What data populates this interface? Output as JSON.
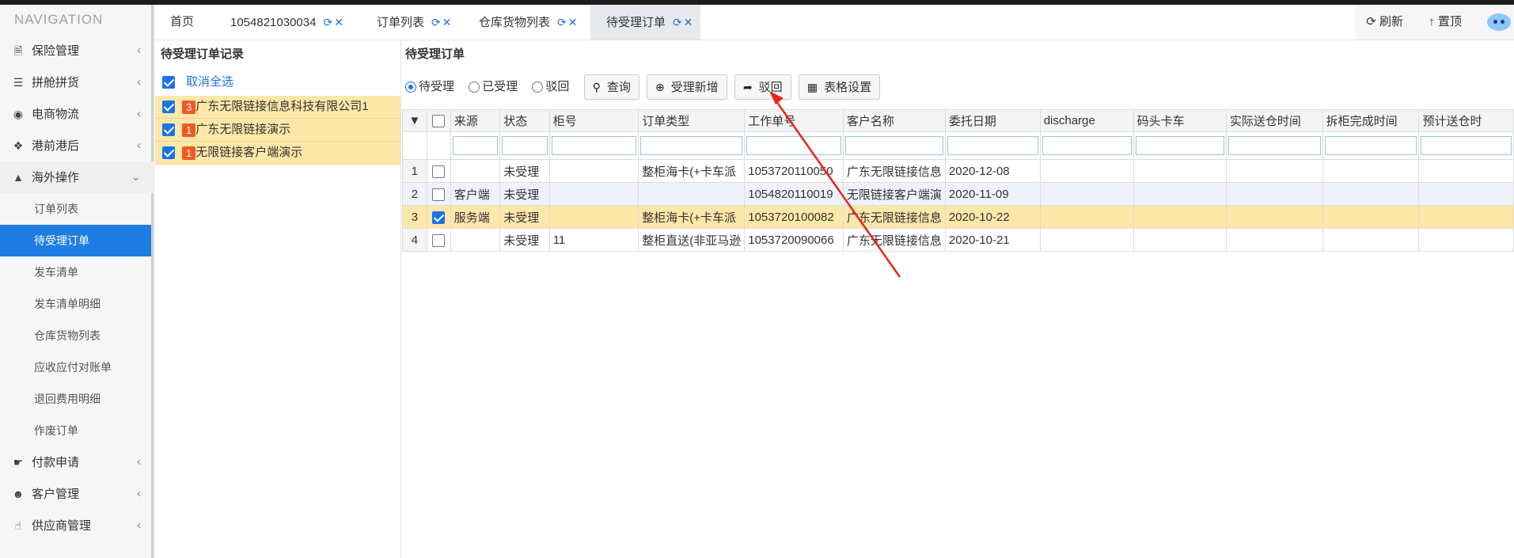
{
  "sidebar": {
    "title": "NAVIGATION",
    "menu": [
      {
        "label": "保险管理",
        "icon": "document-icon"
      },
      {
        "label": "拼舱拼货",
        "icon": "list-icon"
      },
      {
        "label": "电商物流",
        "icon": "globe-icon"
      },
      {
        "label": "港前港后",
        "icon": "cubes-icon"
      },
      {
        "label": "海外操作",
        "icon": "bank-icon",
        "expanded": true
      }
    ],
    "submenu": [
      "订单列表",
      "待受理订单",
      "发车清单",
      "发车清单明细",
      "仓库货物列表",
      "应收应付对账单",
      "退回费用明细",
      "作废订单"
    ],
    "active_sub": "待受理订单",
    "menu_after": [
      {
        "label": "付款申请",
        "icon": "hand-coins-icon"
      },
      {
        "label": "客户管理",
        "icon": "users-icon"
      },
      {
        "label": "供应商管理",
        "icon": "thumbs-up-icon"
      }
    ]
  },
  "tabs": [
    {
      "label": "首页",
      "refreshable": false
    },
    {
      "label": "1054821030034",
      "refreshable": true
    },
    {
      "label": "订单列表",
      "refreshable": true
    },
    {
      "label": "仓库货物列表",
      "refreshable": true
    },
    {
      "label": "待受理订单",
      "refreshable": true,
      "active": true
    }
  ],
  "topright": {
    "refresh": "刷新",
    "top": "置顶"
  },
  "left_panel": {
    "title": "待受理订单记录",
    "select_all": "取消全选",
    "records": [
      {
        "count": "3",
        "name": "广东无限链接信息科技有限公司1"
      },
      {
        "count": "1",
        "name": "广东无限链接演示"
      },
      {
        "count": "1",
        "name": "无限链接客户端演示"
      }
    ]
  },
  "main": {
    "title": "待受理订单",
    "radios": [
      {
        "label": "待受理",
        "checked": true
      },
      {
        "label": "已受理",
        "checked": false
      },
      {
        "label": "驳回",
        "checked": false
      }
    ],
    "buttons": {
      "query": "查询",
      "accept_new": "受理新增",
      "reject": "驳回",
      "table_settings": "表格设置"
    },
    "columns": [
      "来源",
      "状态",
      "柜号",
      "订单类型",
      "工作单号",
      "客户名称",
      "委托日期",
      "discharge",
      "码头卡车",
      "实际送仓时间",
      "拆柜完成时间",
      "预计送仓时"
    ],
    "rows": [
      {
        "num": "1",
        "checked": false,
        "cells": [
          "",
          "未受理",
          "",
          "整柜海卡(+卡车派",
          "1053720110050",
          "广东无限链接信息",
          "2020-12-08",
          "",
          "",
          "",
          "",
          ""
        ]
      },
      {
        "num": "2",
        "checked": false,
        "cells": [
          "客户端",
          "未受理",
          "",
          "",
          "1054820110019",
          "无限链接客户端演",
          "2020-11-09",
          "",
          "",
          "",
          "",
          ""
        ]
      },
      {
        "num": "3",
        "checked": true,
        "cells": [
          "服务端",
          "未受理",
          "",
          "整柜海卡(+卡车派",
          "1053720100082",
          "广东无限链接信息",
          "2020-10-22",
          "",
          "",
          "",
          "",
          ""
        ]
      },
      {
        "num": "4",
        "checked": false,
        "cells": [
          "",
          "未受理",
          "11",
          "整柜直送(非亚马逊",
          "1053720090066",
          "广东无限链接信息",
          "2020-10-21",
          "",
          "",
          "",
          "",
          ""
        ]
      }
    ]
  },
  "colors": {
    "accent": "#1d7de3",
    "selected_row": "#fde7a9",
    "badge": "#f05a22",
    "annotation_arrow": "#e8261e"
  }
}
